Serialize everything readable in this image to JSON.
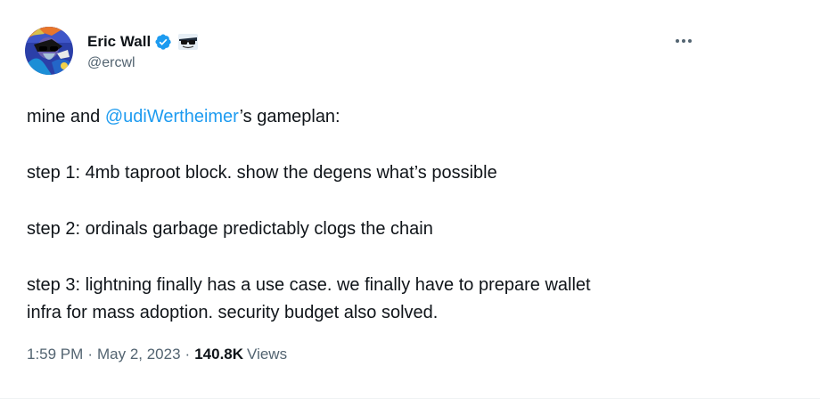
{
  "author": {
    "display_name": "Eric Wall",
    "handle": "@ercwl",
    "avatar_icon": "profile-avatar-cartoon",
    "verified_icon": "verified-badge-icon",
    "affiliate_icon": "sunglasses-emoji-icon"
  },
  "menu": {
    "more_icon": "more-options-icon"
  },
  "tweet": {
    "line1_prefix": "mine and ",
    "line1_mention": "@udiWertheimer",
    "line1_suffix": "’s gameplan:",
    "step1": "step 1: 4mb taproot block. show the degens what’s possible",
    "step2": "step 2: ordinals garbage predictably clogs the chain",
    "step3_line1": "step 3: lightning finally has a use case. we finally have to prepare wallet",
    "step3_line2": "infra for mass adoption. security budget also solved."
  },
  "meta": {
    "time": "1:59 PM",
    "separator": "·",
    "date": "May 2, 2023",
    "views_count": "140.8K",
    "views_label": "Views"
  },
  "colors": {
    "accent": "#1d9bf0",
    "text": "#0f1419",
    "muted": "#536471"
  }
}
